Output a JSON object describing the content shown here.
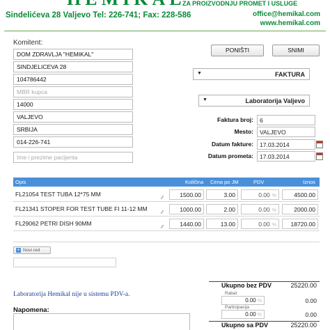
{
  "header": {
    "logo": "HEMIKAL",
    "subtitle": "ZA PROIZVODNJU PROMET I USLUGE",
    "address_line": "Sindelićeva 28 Valjevo   Tel: 226-741;   Fax: 228-586",
    "email": "office@hemikal.com",
    "web": "www.hemikal.com"
  },
  "colors": {
    "brand_green": "#0a8a3a",
    "table_header": "#4a90d9",
    "note_blue": "#1f3c9e"
  },
  "customer": {
    "label": "Komitent:",
    "name": "DOM ZDRAVLJA \"HEMIKAL\"",
    "street": "SINDJELICEVA 28",
    "pib": "104786442",
    "mbr_placeholder": "MBR kupca",
    "zip": "14000",
    "city": "VALJEVO",
    "country": "SRBIJA",
    "phone": "014-226-741",
    "patient_placeholder": "Ime i prezime pacijenta"
  },
  "buttons": {
    "cancel": "PONIŠTI",
    "save": "SNIMI"
  },
  "doc_type": {
    "selected": "FAKTURA"
  },
  "lab": {
    "selected": "Laboratorija Valjevo"
  },
  "invoice": {
    "number_label": "Faktura broj:",
    "number": "6",
    "place_label": "Mesto:",
    "place": "VALJEVO",
    "date_label": "Datum fakture:",
    "date": "17.03.2014",
    "service_date_label": "Datum prometa:",
    "service_date": "17.03.2014"
  },
  "items": {
    "headers": {
      "opis": "Opis",
      "kolicina": "Količina",
      "cena": "Cena po JM",
      "pdv": "PDV",
      "iznos": "Iznos"
    },
    "pct": "%",
    "rows": [
      {
        "opis": "FL21054 TEST TUBA 12*75 MM",
        "kolicina": "1500.00",
        "cena": "3.00",
        "pdv": "0.00",
        "iznos": "4500.00"
      },
      {
        "opis": "FL21341 STOPER FOR TEST TUBE FI 11-12 MM",
        "kolicina": "1000.00",
        "cena": "2.00",
        "pdv": "0.00",
        "iznos": "2000.00"
      },
      {
        "opis": "FL29062 PETRI DISH 90MM",
        "kolicina": "1440.00",
        "cena": "13.00",
        "pdv": "0.00",
        "iznos": "18720.00"
      }
    ],
    "add_row": "Novi red"
  },
  "notes": {
    "pdv_note": "Laboratorija Hemikal nije u sistemu PDV-a.",
    "napomena_label": "Napomena:"
  },
  "totals": {
    "without_vat_label": "Ukupno bez PDV",
    "without_vat": "25220.00",
    "rabat_label": "Rabat",
    "rabat": "0.00",
    "rabat_value": "0.00",
    "participacija_label": "Participacija",
    "participacija": "0.00",
    "participacija_value": "0.00",
    "with_vat_label": "Ukupno sa PDV",
    "with_vat": "25220.00"
  }
}
